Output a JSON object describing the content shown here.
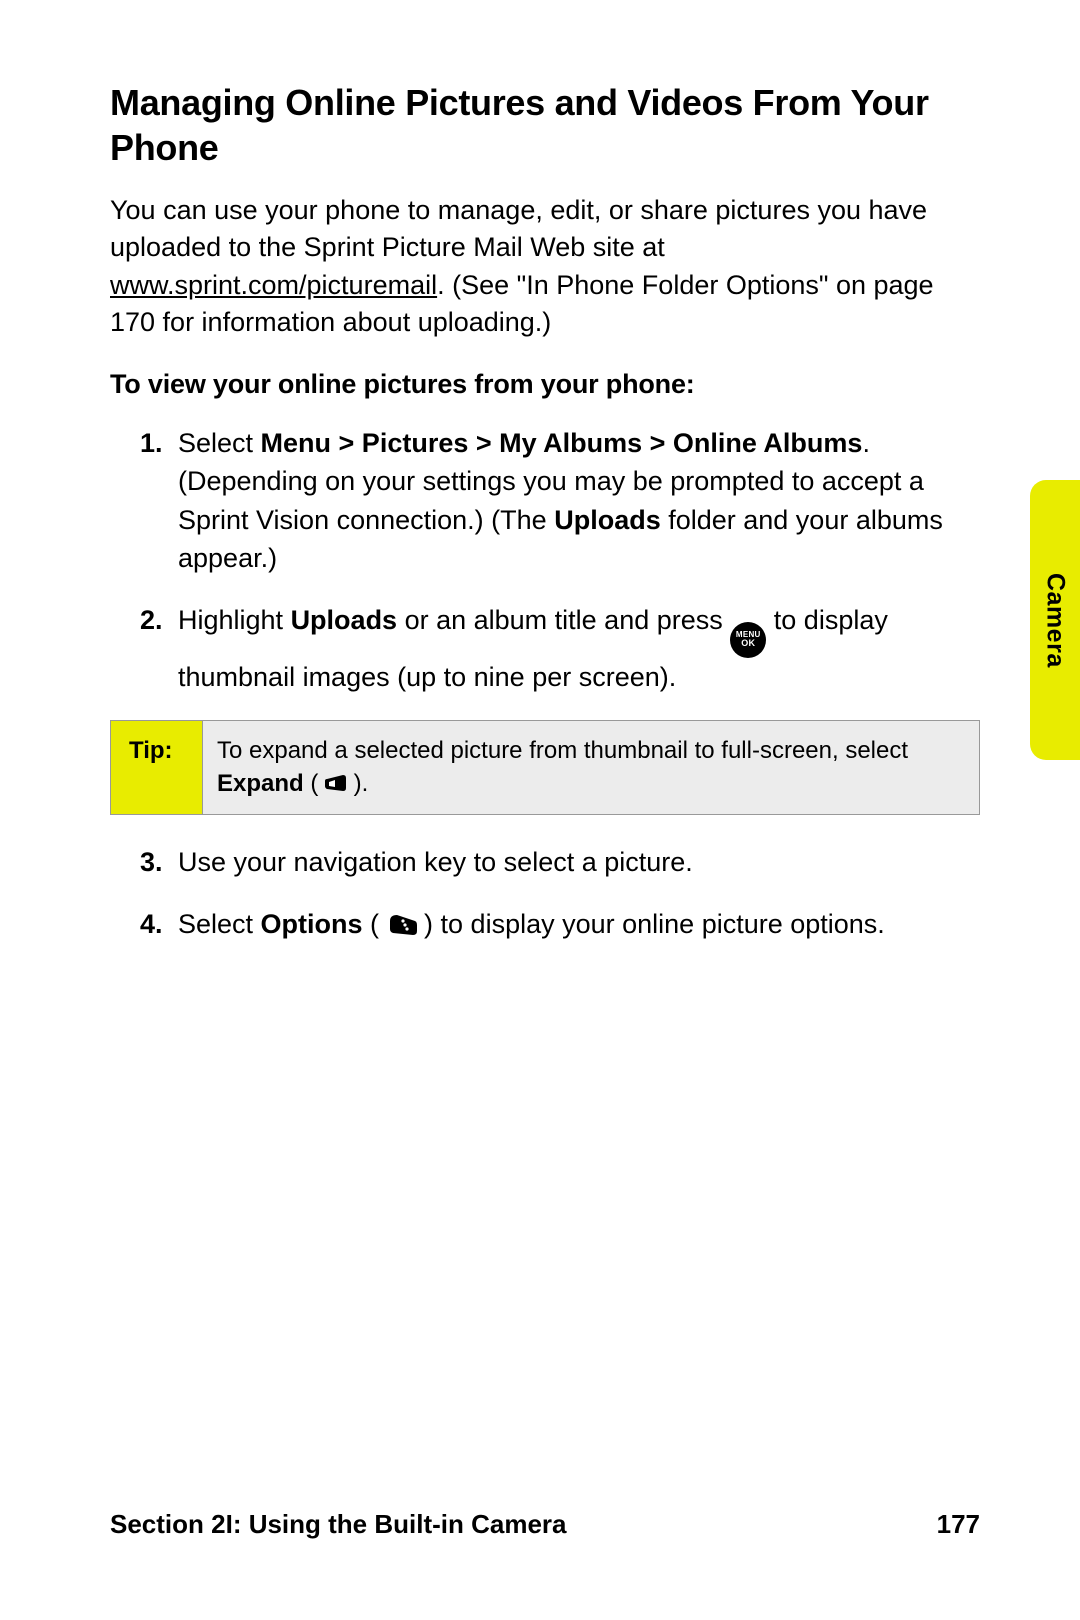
{
  "heading": "Managing Online Pictures and Videos From Your Phone",
  "intro": {
    "p1": "You can use your phone to manage, edit, or share pictures you have uploaded to the Sprint Picture Mail Web site at ",
    "url": "www.sprint.com/picturemail",
    "p2": ".  (See \"In Phone Folder Options\" on page 170 for information about uploading.)"
  },
  "subhead": "To view your online pictures from your phone:",
  "steps": {
    "s1": {
      "num": "1.",
      "pre": "Select ",
      "bold": "Menu > Pictures > My Albums > Online Albums",
      "post1": ". (Depending on your settings you may be prompted to accept a Sprint Vision connection.) (The ",
      "bold2": "Uploads",
      "post2": " folder and your albums appear.)"
    },
    "s2": {
      "num": "2.",
      "pre": "Highlight ",
      "bold": "Uploads",
      "mid": " or an album title and press ",
      "post": " to display thumbnail images (up to nine per screen)."
    },
    "s3": {
      "num": "3.",
      "text": "Use your navigation key to select a picture."
    },
    "s4": {
      "num": "4.",
      "pre": "Select ",
      "bold": "Options",
      "mid": " ( ",
      "post": " ) to display your online picture options."
    }
  },
  "tip": {
    "label": "Tip:",
    "pre": "To expand a selected picture from thumbnail to full-screen, select ",
    "bold": "Expand",
    "mid": " ( ",
    "post": " )."
  },
  "button": {
    "menu": "MENU",
    "ok": "OK"
  },
  "side_tab": "Camera",
  "footer": {
    "section": "Section 2I: Using the Built-in Camera",
    "page": "177"
  }
}
